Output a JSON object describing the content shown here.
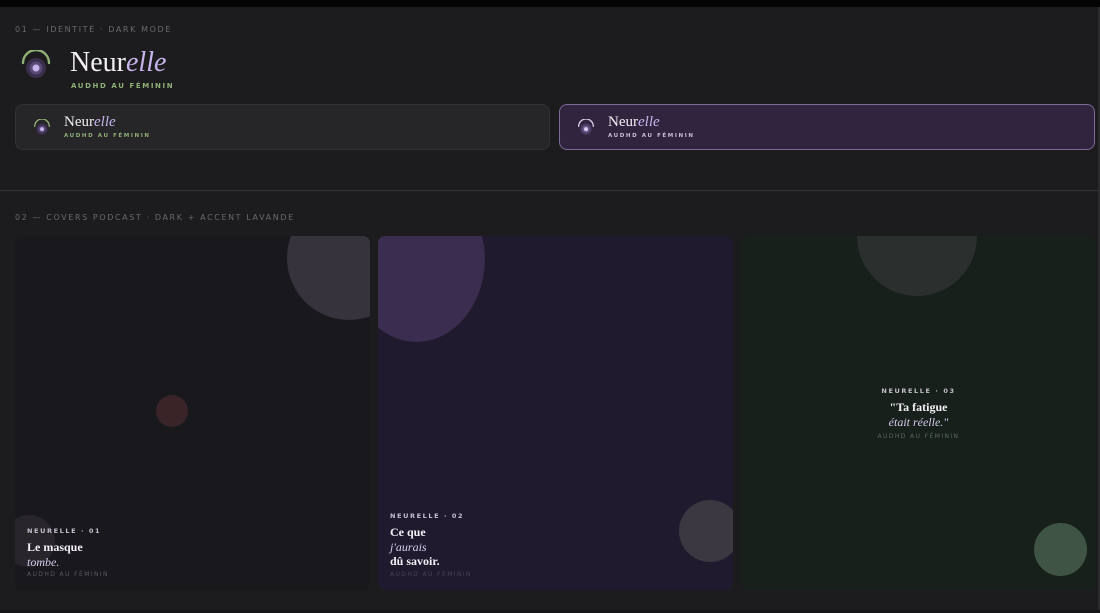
{
  "sections": {
    "identity_label": "01 — IDENTITÉ · DARK MODE",
    "covers_label": "02 — COVERS PODCAST · DARK + ACCENT LAVANDE"
  },
  "brand": {
    "name_roman": "Neur",
    "name_italic": "elle",
    "tagline": "AUDHD AU FÉMININ"
  },
  "colors": {
    "background": "#1c1b1d",
    "lavender": "#c7b4ec",
    "sage": "#8fb077",
    "lavender_panel": "#30243f"
  },
  "covers": [
    {
      "tag": "NEURELLE · 01",
      "line1": "Le masque",
      "line2": "tombe.",
      "sub": "AUDHD AU FÉMININ"
    },
    {
      "tag": "NEURELLE · 02",
      "line1": "Ce que",
      "line2": "j'aurais",
      "line3": "dû savoir.",
      "sub": "AUDHD AU FÉMININ"
    },
    {
      "tag": "NEURELLE · 03",
      "line1": "\"Ta fatigue",
      "line2": "était réelle.\"",
      "sub": "AUDHD AU FÉMININ"
    }
  ]
}
